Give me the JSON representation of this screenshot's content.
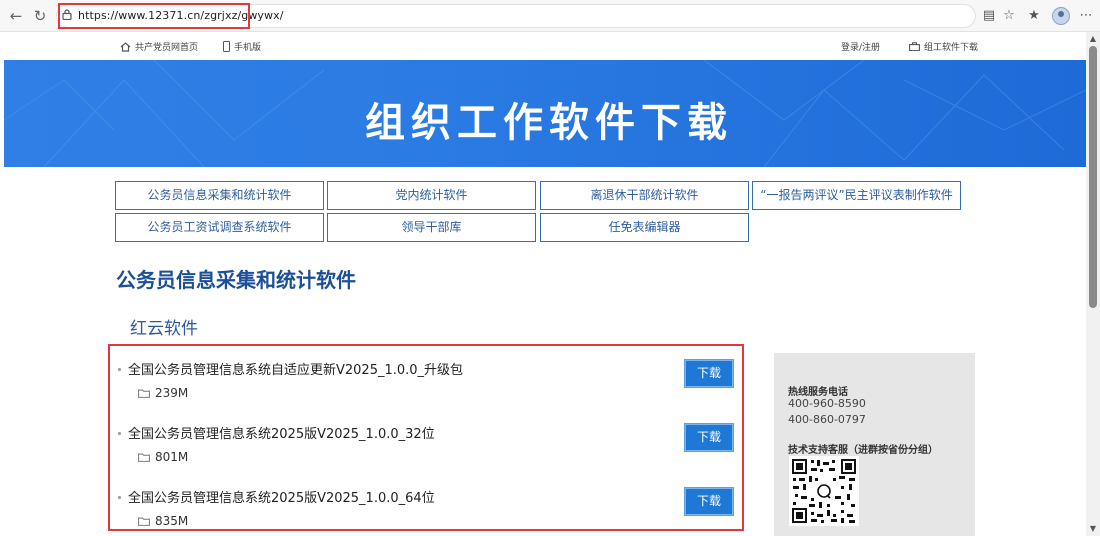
{
  "browser": {
    "url": "https://www.12371.cn/zgrjxz/gwywx/"
  },
  "topnav": {
    "home_link": "共产党员网首页",
    "mobile_link": "手机版",
    "login_link": "登录/注册",
    "software_link": "组工软件下载"
  },
  "banner": {
    "title": "组织工作软件下载"
  },
  "tabs": [
    "公务员信息采集和统计软件",
    "党内统计软件",
    "离退休干部统计软件",
    "“一报告两评议”民主评议表制作软件",
    "公务员工资试调查系统软件",
    "领导干部库",
    "任免表编辑器"
  ],
  "section": {
    "title": "公务员信息采集和统计软件",
    "subtitle": "红云软件"
  },
  "downloads": [
    {
      "name": "全国公务员管理信息系统自适应更新V2025_1.0.0_升级包",
      "size": "239M",
      "button": "下载"
    },
    {
      "name": "全国公务员管理信息系统2025版V2025_1.0.0_32位",
      "size": "801M",
      "button": "下载"
    },
    {
      "name": "全国公务员管理信息系统2025版V2025_1.0.0_64位",
      "size": "835M",
      "button": "下载"
    }
  ],
  "sidebar": {
    "hotline_title": "热线服务电话",
    "phone1": "400-960-8590",
    "phone2": "400-860-0797",
    "support_title": "技术支持客服（进群按省份分组）"
  },
  "colors": {
    "accent": "#1f77d6",
    "banner": "#2b7be4",
    "highlight": "#e0383c",
    "title": "#1c4f97"
  }
}
